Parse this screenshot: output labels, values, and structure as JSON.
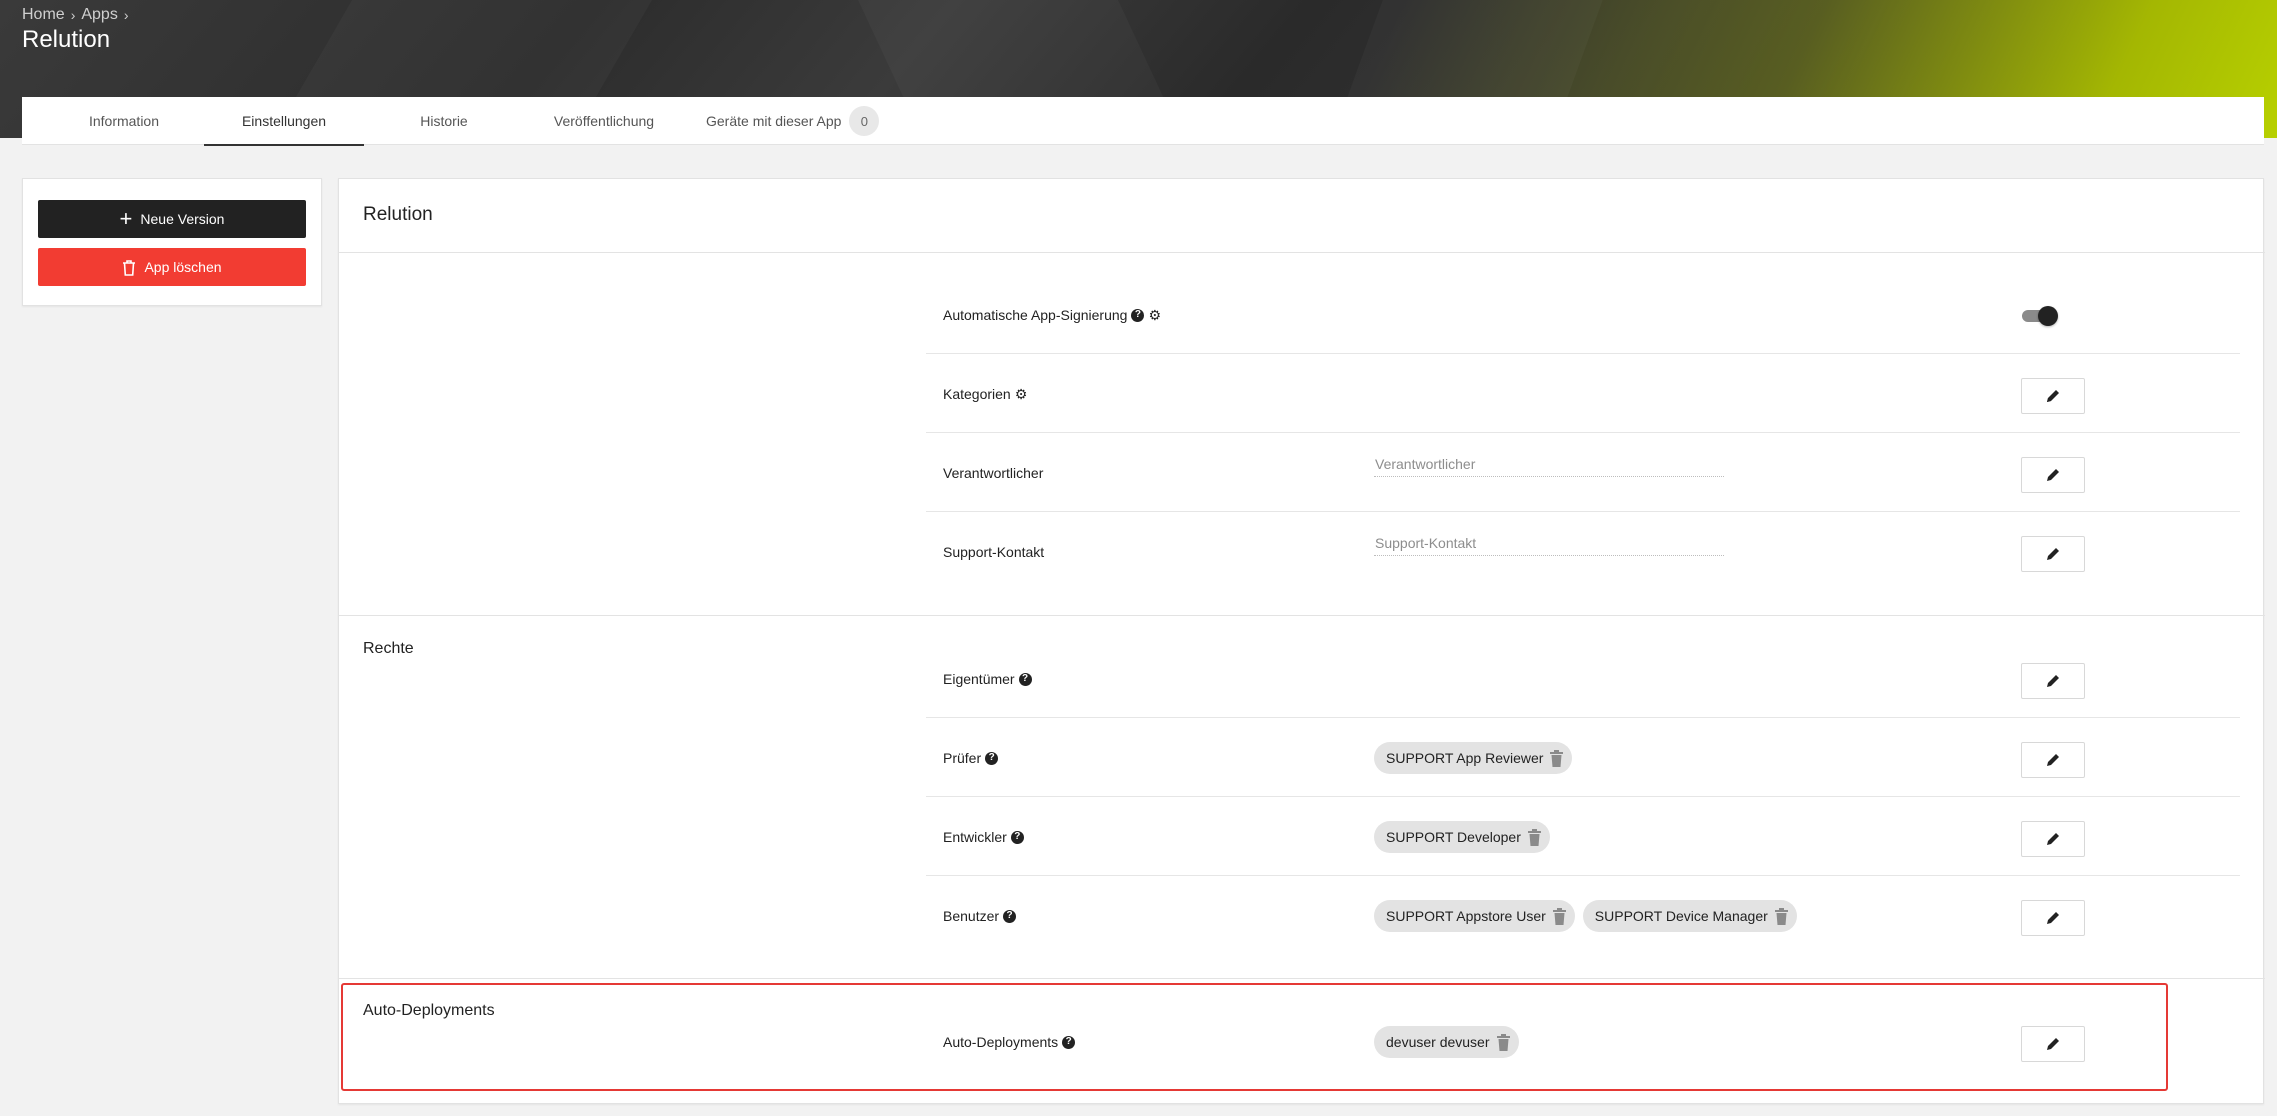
{
  "breadcrumb": {
    "items": [
      "Home",
      "Apps"
    ]
  },
  "page": {
    "title": "Relution"
  },
  "tabs": [
    {
      "label": "Information"
    },
    {
      "label": "Einstellungen",
      "active": true
    },
    {
      "label": "Historie"
    },
    {
      "label": "Veröffentlichung"
    },
    {
      "label": "Geräte mit dieser App",
      "count": "0"
    }
  ],
  "actions": {
    "new_version": "Neue Version",
    "delete_app": "App löschen"
  },
  "card": {
    "title": "Relution"
  },
  "general": {
    "auto_signing": {
      "label": "Automatische App-Signierung",
      "enabled": true
    },
    "categories": {
      "label": "Kategorien"
    },
    "responsible": {
      "label": "Verantwortlicher",
      "placeholder": "Verantwortlicher"
    },
    "support": {
      "label": "Support-Kontakt",
      "placeholder": "Support-Kontakt"
    }
  },
  "rights": {
    "section_label": "Rechte",
    "owner": {
      "label": "Eigentümer"
    },
    "reviewer": {
      "label": "Prüfer",
      "chips": [
        "SUPPORT App Reviewer"
      ]
    },
    "developer": {
      "label": "Entwickler",
      "chips": [
        "SUPPORT Developer"
      ]
    },
    "user": {
      "label": "Benutzer",
      "chips": [
        "SUPPORT Appstore User",
        "SUPPORT Device Manager"
      ]
    }
  },
  "auto_deployments": {
    "section_label": "Auto-Deployments",
    "label": "Auto-Deployments",
    "chips": [
      "devuser devuser"
    ]
  },
  "colors": {
    "danger": "#f23c32",
    "highlight": "#e53935",
    "dark": "#222222",
    "accent": "#b7d000"
  }
}
